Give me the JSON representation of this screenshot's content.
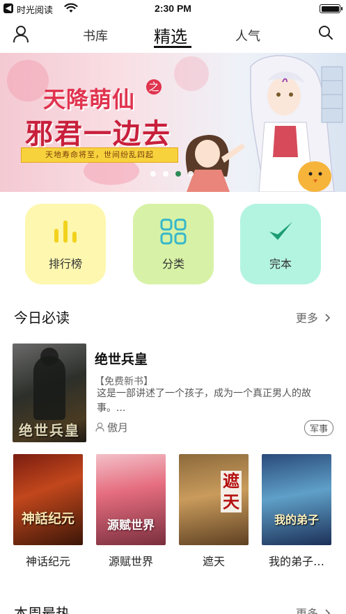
{
  "status_bar": {
    "app_name": "时光阅读",
    "time": "2:30 PM",
    "back_glyph": "◀"
  },
  "nav": {
    "tabs": [
      "书库",
      "精选",
      "人气"
    ],
    "active_tab": "精选",
    "icons": [
      "user-icon",
      "search-icon"
    ]
  },
  "banner": {
    "title_line1": "天降萌仙",
    "title_line1_suffix": "之",
    "title_line2": "邪君一边去",
    "tagline": "天地寿命将至，世间纷乱四起",
    "dot_count": 4,
    "active_dot": 3
  },
  "shortcuts": [
    {
      "label": "排行榜",
      "icon": "bar-chart-icon",
      "color": "#fdf7b0",
      "icon_color": "#f2d21d"
    },
    {
      "label": "分类",
      "icon": "grid-icon",
      "color": "#d7f2a6",
      "icon_color": "#37b7c9"
    },
    {
      "label": "完本",
      "icon": "checkmark-icon",
      "color": "#b3f4e0",
      "icon_color": "#1c9c72"
    }
  ],
  "today_section": {
    "title": "今日必读",
    "more": "更多"
  },
  "featured_book": {
    "title": "绝世兵皇",
    "tag": "【免费新书】",
    "description": "这是一部讲述了一个孩子，成为一个真正男人的故事。...",
    "author": "傲月",
    "category": "军事",
    "cover_text": "绝世兵皇"
  },
  "book_grid": [
    {
      "title": "神话纪元",
      "cover_text": "神話纪元"
    },
    {
      "title": "源赋世界",
      "cover_text": "源赋世界"
    },
    {
      "title": "遮天",
      "cover_text": "遮天"
    },
    {
      "title": "我的弟子…",
      "cover_text": "我的弟子"
    }
  ],
  "week_section": {
    "title": "本周最热",
    "more": "更多"
  }
}
